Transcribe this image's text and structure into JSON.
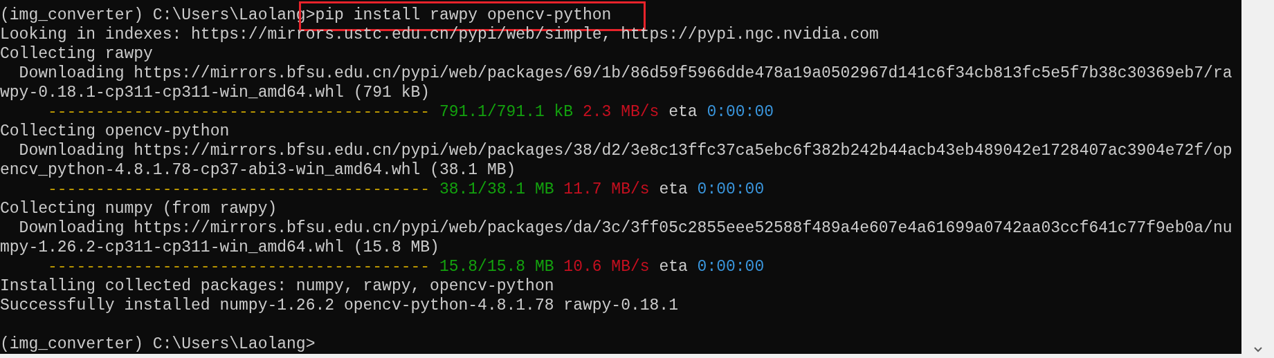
{
  "terminal": {
    "lines": [
      {
        "kind": "output",
        "spans": [
          {
            "kind": "prompt",
            "text": "(img_converter) C:\\Users\\Laolang>"
          },
          {
            "kind": "command",
            "text": "pip install rawpy opencv-python",
            "highlighted": true
          }
        ]
      },
      {
        "kind": "output",
        "spans": [
          {
            "kind": "output",
            "text": "Looking in indexes: https://mirrors.ustc.edu.cn/pypi/web/simple, https://pypi.ngc.nvidia.com"
          }
        ]
      },
      {
        "kind": "output",
        "spans": [
          {
            "kind": "output",
            "text": "Collecting rawpy"
          }
        ]
      },
      {
        "kind": "output",
        "spans": [
          {
            "kind": "output",
            "text": "  Downloading https://mirrors.bfsu.edu.cn/pypi/web/packages/69/1b/86d59f5966dde478a19a0502967d141c6f34cb813fc5e5f7b38c30369eb7/ra"
          }
        ]
      },
      {
        "kind": "output",
        "spans": [
          {
            "kind": "output",
            "text": "wpy-0.18.1-cp311-cp311-win_amd64.whl (791 kB)"
          }
        ]
      },
      {
        "kind": "progress",
        "spans": [
          {
            "kind": "bar",
            "text": "     ----------------------------------------"
          },
          {
            "kind": "size",
            "text": "791.1/791.1 kB"
          },
          {
            "kind": "rate",
            "text": "2.3 MB/s"
          },
          {
            "kind": "output",
            "text": "eta"
          },
          {
            "kind": "time",
            "text": "0:00:00"
          }
        ]
      },
      {
        "kind": "output",
        "spans": [
          {
            "kind": "output",
            "text": "Collecting opencv-python"
          }
        ]
      },
      {
        "kind": "output",
        "spans": [
          {
            "kind": "output",
            "text": "  Downloading https://mirrors.bfsu.edu.cn/pypi/web/packages/38/d2/3e8c13ffc37ca5ebc6f382b242b44acb43eb489042e1728407ac3904e72f/op"
          }
        ]
      },
      {
        "kind": "output",
        "spans": [
          {
            "kind": "output",
            "text": "encv_python-4.8.1.78-cp37-abi3-win_amd64.whl (38.1 MB)"
          }
        ]
      },
      {
        "kind": "progress",
        "spans": [
          {
            "kind": "bar",
            "text": "     ----------------------------------------"
          },
          {
            "kind": "size",
            "text": "38.1/38.1 MB"
          },
          {
            "kind": "rate",
            "text": "11.7 MB/s"
          },
          {
            "kind": "output",
            "text": "eta"
          },
          {
            "kind": "time",
            "text": "0:00:00"
          }
        ]
      },
      {
        "kind": "output",
        "spans": [
          {
            "kind": "output",
            "text": "Collecting numpy (from rawpy)"
          }
        ]
      },
      {
        "kind": "output",
        "spans": [
          {
            "kind": "output",
            "text": "  Downloading https://mirrors.bfsu.edu.cn/pypi/web/packages/da/3c/3ff05c2855eee52588f489a4e607e4a61699a0742aa03ccf641c77f9eb0a/nu"
          }
        ]
      },
      {
        "kind": "output",
        "spans": [
          {
            "kind": "output",
            "text": "mpy-1.26.2-cp311-cp311-win_amd64.whl (15.8 MB)"
          }
        ]
      },
      {
        "kind": "progress",
        "spans": [
          {
            "kind": "bar",
            "text": "     ----------------------------------------"
          },
          {
            "kind": "size",
            "text": "15.8/15.8 MB"
          },
          {
            "kind": "rate",
            "text": "10.6 MB/s"
          },
          {
            "kind": "output",
            "text": "eta"
          },
          {
            "kind": "time",
            "text": "0:00:00"
          }
        ]
      },
      {
        "kind": "output",
        "spans": [
          {
            "kind": "output",
            "text": "Installing collected packages: numpy, rawpy, opencv-python"
          }
        ]
      },
      {
        "kind": "output",
        "spans": [
          {
            "kind": "output",
            "text": "Successfully installed numpy-1.26.2 opencv-python-4.8.1.78 rawpy-0.18.1"
          }
        ]
      },
      {
        "kind": "blank"
      },
      {
        "kind": "output",
        "spans": [
          {
            "kind": "prompt",
            "text": "(img_converter) C:\\Users\\Laolang>"
          }
        ]
      }
    ]
  }
}
